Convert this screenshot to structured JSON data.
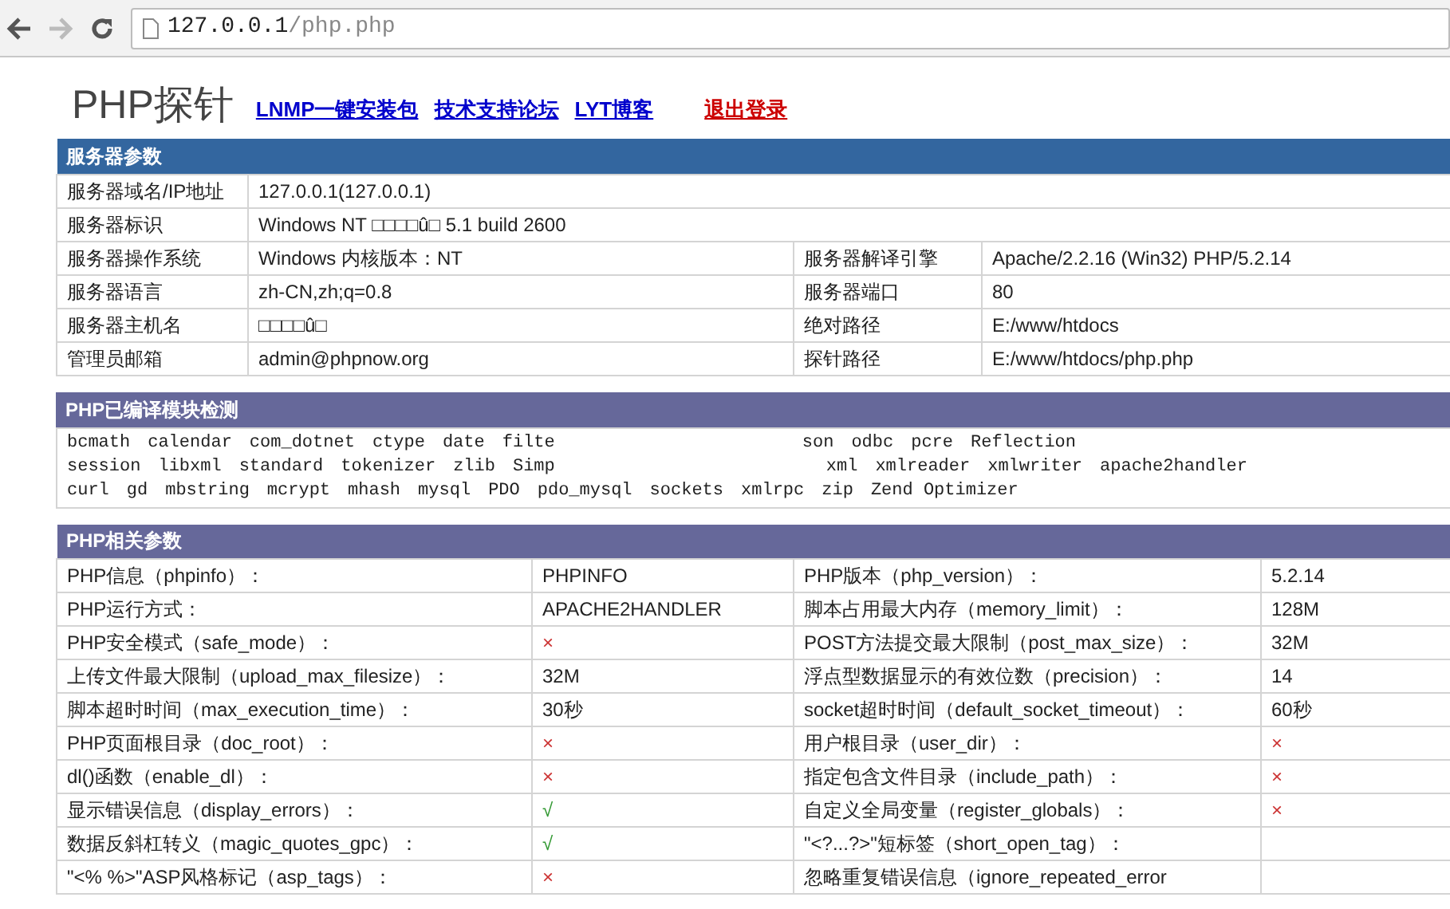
{
  "browser": {
    "url_host": "127.0.0.1",
    "url_path": "/php.php"
  },
  "header": {
    "title": "PHP探针",
    "links": [
      {
        "label": "LNMP一键安装包",
        "kind": "nav"
      },
      {
        "label": "技术支持论坛",
        "kind": "nav"
      },
      {
        "label": "LYT博客",
        "kind": "nav"
      },
      {
        "label": "退出登录",
        "kind": "logout"
      }
    ]
  },
  "server": {
    "title": "服务器参数",
    "rows": [
      {
        "cells": [
          {
            "text": "服务器域名/IP地址"
          },
          {
            "text": "127.0.0.1(127.0.0.1)",
            "colspan": 3
          }
        ]
      },
      {
        "cells": [
          {
            "text": "服务器标识"
          },
          {
            "text": "Windows NT □□□□û□ 5.1 build 2600",
            "colspan": 3
          }
        ]
      },
      {
        "cells": [
          {
            "text": "服务器操作系统"
          },
          {
            "text": "Windows  内核版本：NT"
          },
          {
            "text": "服务器解译引擎"
          },
          {
            "text": "Apache/2.2.16 (Win32) PHP/5.2.14"
          }
        ]
      },
      {
        "cells": [
          {
            "text": "服务器语言"
          },
          {
            "text": "zh-CN,zh;q=0.8"
          },
          {
            "text": "服务器端口"
          },
          {
            "text": "80"
          }
        ]
      },
      {
        "cells": [
          {
            "text": "服务器主机名"
          },
          {
            "text": "□□□□û□"
          },
          {
            "text": "绝对路径"
          },
          {
            "text": "E:/www/htdocs"
          }
        ]
      },
      {
        "cells": [
          {
            "text": "管理员邮箱"
          },
          {
            "text": "admin@phpnow.org"
          },
          {
            "text": "探针路径"
          },
          {
            "text": "E:/www/htdocs/php.php"
          }
        ]
      }
    ]
  },
  "modules": {
    "title": "PHP已编译模块检测",
    "lines": [
      {
        "left": [
          "bcmath",
          "calendar",
          "com_dotnet",
          "ctype",
          "date",
          "filte"
        ],
        "right": [
          "son",
          "odbc",
          "pcre",
          "Reflection"
        ]
      },
      {
        "left": [
          "session",
          "libxml",
          "standard",
          "tokenizer",
          "zlib",
          "Simp"
        ],
        "right": [
          "xml",
          "xmlreader",
          "xmlwriter",
          "apache2handler"
        ]
      },
      {
        "left": [
          "curl",
          "gd",
          "mbstring",
          "mcrypt",
          "mhash",
          "mysql",
          "PDO",
          "pdo_mysql",
          "sockets",
          "xmlrpc",
          "zip",
          "Zend Optimizer"
        ]
      }
    ]
  },
  "php": {
    "title": "PHP相关参数",
    "rows": [
      {
        "label": "PHP信息（phpinfo）：",
        "value": "PHPINFO",
        "label2": "PHP版本（php_version）：",
        "value2": "5.2.14"
      },
      {
        "label": "PHP运行方式：",
        "value": "APACHE2HANDLER",
        "label2": "脚本占用最大内存（memory_limit）：",
        "value2": "128M"
      },
      {
        "label": "PHP安全模式（safe_mode）：",
        "value": "×",
        "pass": false,
        "label2": "POST方法提交最大限制（post_max_size）：",
        "value2": "32M"
      },
      {
        "label": "上传文件最大限制（upload_max_filesize）：",
        "value": "32M",
        "label2": "浮点型数据显示的有效位数（precision）：",
        "value2": "14"
      },
      {
        "label": "脚本超时时间（max_execution_time）：",
        "value": "30秒",
        "label2": "socket超时时间（default_socket_timeout）：",
        "value2": "60秒"
      },
      {
        "label": "PHP页面根目录（doc_root）：",
        "value": "×",
        "pass": false,
        "label2": "用户根目录（user_dir）：",
        "value2": "×",
        "pass2": false
      },
      {
        "label": "dl()函数（enable_dl）：",
        "value": "×",
        "pass": false,
        "label2": "指定包含文件目录（include_path）：",
        "value2": "×",
        "pass2": false
      },
      {
        "label": "显示错误信息（display_errors）：",
        "value": "√",
        "pass": true,
        "label2": "自定义全局变量（register_globals）：",
        "value2": "×",
        "pass2": false
      },
      {
        "label": "数据反斜杠转义（magic_quotes_gpc）：",
        "value": "√",
        "pass": true,
        "label2": "\"<?...?>\"短标签（short_open_tag）："
      },
      {
        "label": "\"<% %>\"ASP风格标记（asp_tags）：",
        "value": "×",
        "pass": false,
        "label2": "忽略重复错误信息（ignore_repeated_error"
      }
    ]
  }
}
